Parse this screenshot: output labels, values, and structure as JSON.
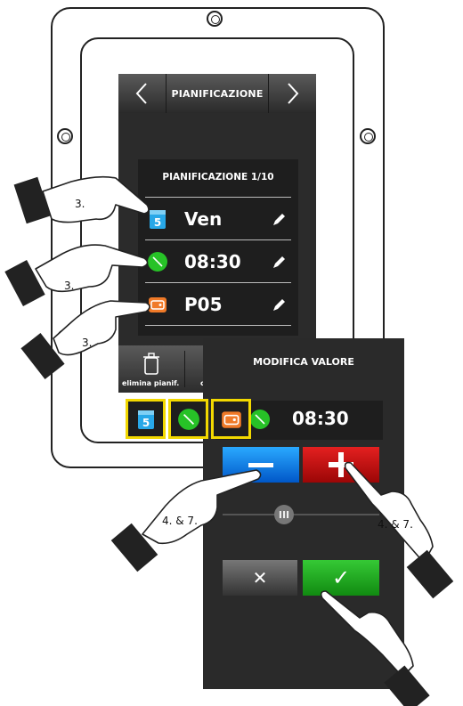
{
  "main_screen": {
    "title": "PIANIFICAZIONE",
    "prev_symbol": "<",
    "next_symbol": ">",
    "panel_title": "PIANIFICAZIONE  1/10",
    "rows": [
      {
        "icon": "calendar-icon",
        "value": "Ven"
      },
      {
        "icon": "clock-icon",
        "value": "08:30"
      },
      {
        "icon": "program-icon",
        "value": "P05"
      }
    ],
    "bottom": {
      "delete_label": "elimina pianif.",
      "next_label_fragment": "c"
    }
  },
  "modal": {
    "title": "MODIFICA VALORE",
    "value": "08:30",
    "slider_symbol": "III",
    "cancel_symbol": "✕",
    "confirm_symbol": "✓"
  },
  "callouts": {
    "step3": "3.",
    "step47": "4. & 7."
  },
  "icons": {
    "calendar_day": "5",
    "colors": {
      "calendar": "#28a8e8",
      "clock": "#27c227",
      "program": "#f07a28",
      "highlight": "#f2d800"
    }
  }
}
